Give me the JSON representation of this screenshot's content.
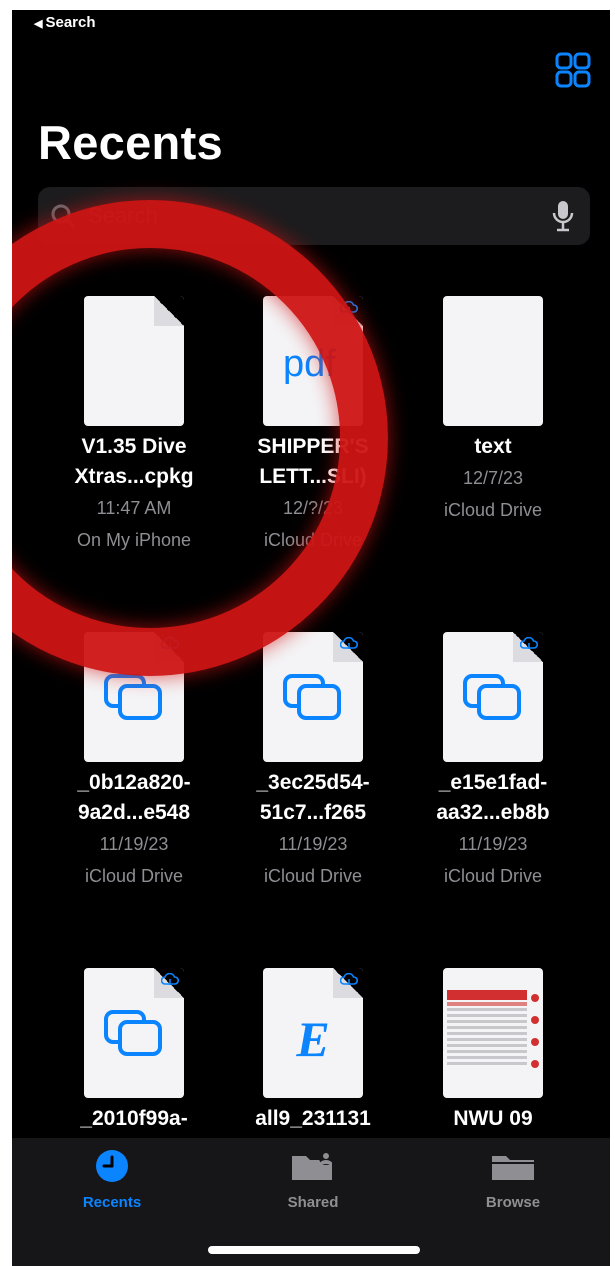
{
  "nav": {
    "back_label": "Search"
  },
  "header": {
    "title": "Recents"
  },
  "search": {
    "placeholder": "Search"
  },
  "files": [
    {
      "name": "V1.35 Dive\nXtras...cpkg",
      "date": "11:47 AM",
      "location": "On My iPhone",
      "icon": "blank-document-icon"
    },
    {
      "name": "SHIPPER'S\nLETT...SLI)",
      "date": "12/?/23",
      "location": "iCloud Drive",
      "icon": "pdf-icon"
    },
    {
      "name": "text",
      "date": "12/7/23",
      "location": "iCloud Drive",
      "icon": "blank-document-icon"
    },
    {
      "name": "_0b12a820-\n9a2d...e548",
      "date": "11/19/23",
      "location": "iCloud Drive",
      "icon": "window-stack-icon"
    },
    {
      "name": "_3ec25d54-\n51c7...f265",
      "date": "11/19/23",
      "location": "iCloud Drive",
      "icon": "window-stack-icon"
    },
    {
      "name": "_e15e1fad-\naa32...eb8b",
      "date": "11/19/23",
      "location": "iCloud Drive",
      "icon": "window-stack-icon"
    },
    {
      "name": "_2010f99a-",
      "icon": "window-stack-icon"
    },
    {
      "name": "all9_231131",
      "icon": "e-letter-icon"
    },
    {
      "name": "NWU 09",
      "icon": "spreadsheet-preview-icon"
    }
  ],
  "tabs": [
    {
      "label": "Recents",
      "icon": "clock-icon",
      "active": true
    },
    {
      "label": "Shared",
      "icon": "shared-folder-icon",
      "active": false
    },
    {
      "label": "Browse",
      "icon": "folder-icon",
      "active": false
    }
  ],
  "colors": {
    "accent": "#0a84ff",
    "annotation_circle": "#cd1414",
    "background": "#000000"
  }
}
